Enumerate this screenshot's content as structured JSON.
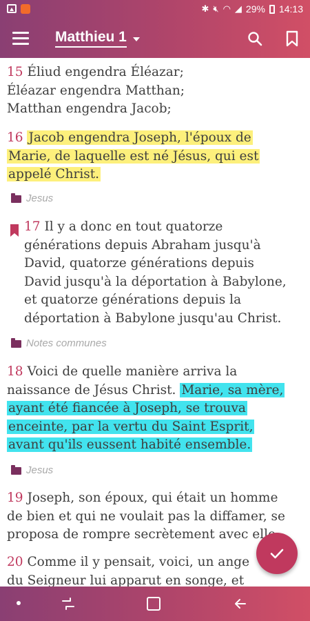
{
  "status_bar": {
    "battery": "29%",
    "time": "14:13",
    "icons": [
      "gallery-icon",
      "app-notification-icon",
      "bluetooth-icon",
      "mute-icon",
      "wifi-icon",
      "signal-icon",
      "battery-icon"
    ]
  },
  "app_bar": {
    "title": "Matthieu 1",
    "icons": [
      "menu-icon",
      "dropdown-caret-icon",
      "search-icon",
      "bookmark-icon"
    ]
  },
  "verses": [
    {
      "num": "15",
      "text": "Éliud engendra Éléazar; Éléazar engendra Matthan; Matthan engendra Jacob;"
    },
    {
      "num": "16",
      "highlight": "yellow",
      "text": "Jacob engendra Joseph, l'époux de Marie, de laquelle est né Jésus, qui est appelé Christ.",
      "tag": "Jesus"
    },
    {
      "num": "17",
      "bookmarked": true,
      "text": "Il y a donc en tout quatorze générations depuis Abraham jusqu'à David, quatorze générations depuis David jusqu'à la déportation à Babylone, et quatorze générations depuis la déportation à Babylone jusqu'au Christ.",
      "tag": "Notes communes"
    },
    {
      "num": "18",
      "text_plain": "Voici de quelle manière arriva la naissance de Jésus Christ.",
      "text_highlight": "Marie, sa mère, ayant été fiancée à Joseph, se trouva enceinte, par la vertu du Saint Esprit, avant qu'ils eussent habité ensemble.",
      "highlight": "cyan",
      "tag": "Jesus"
    },
    {
      "num": "19",
      "text": "Joseph, son époux, qui était un homme de bien et qui ne voulait pas la diffamer, se proposa de rompre secrètement avec elle."
    },
    {
      "num": "20",
      "text": "Comme il y pensait, voici, un ange du Seigneur lui apparut en songe, et"
    }
  ],
  "colors": {
    "bar_start": "#8a3f73",
    "bar_end": "#d14f66",
    "verse_number": "#c0395e",
    "highlight_yellow": "#fdf07c",
    "highlight_cyan": "#42e3ee",
    "tag_folder": "#7a2f5e",
    "fab": "#c0395e"
  },
  "fab": {
    "icon": "check-icon"
  },
  "nav_bar": {
    "icons": [
      "nav-dot-icon",
      "recent-apps-icon",
      "home-icon",
      "back-icon"
    ]
  }
}
